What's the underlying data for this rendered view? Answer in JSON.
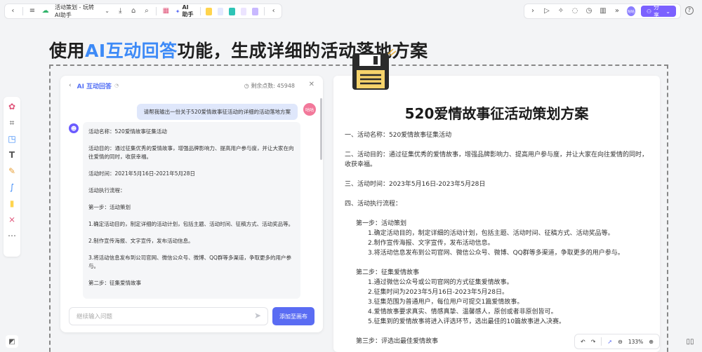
{
  "toolbar": {
    "doc_title": "活动策划 - 玩转AI助手",
    "ai_label": "AI助手",
    "share_label": "分享",
    "avatar_text": "咕咕"
  },
  "headline": {
    "prefix": "使用",
    "highlight": "AI互动回答",
    "suffix": "功能，生成详细的活动落地方案"
  },
  "chat": {
    "title": "AI 互动回答",
    "points_label": "剩余点数: 45948",
    "user_message": "请帮我输出一份关于520爱情故事征活动的详细的活动落地方案",
    "user_avatar": "咕咕",
    "answer_lines": [
      "活动名称：520爱情故事征集活动",
      "活动目的：通过征集优秀的爱情故事，增强品牌影响力、提高用户参与度，并让大家在向往爱情的同时，收获幸福。",
      "活动时间：2021年5月16日-2021年5月28日",
      "活动执行流程：",
      "第一步：活动策划",
      "1.确定活动目的，制定详细的活动计划，包括主题、活动时间、征稿方式、活动奖品等。",
      "2.制作宣传海报、文字宣传，发布活动信息。",
      "3.将活动信息发布到公司官网、微信公众号、微博、QQ群等多渠道，争取更多的用户参与。",
      "第二步：征集爱情故事"
    ],
    "input_placeholder": "继续输入问题",
    "add_button": "添加至画布"
  },
  "document": {
    "title": "520爱情故事征活动策划方案",
    "line_name": "一、活动名称：520爱情故事征集活动",
    "line_goal": "二、活动目的：通过征集优秀的爱情故事，增强品牌影响力、提高用户参与度，并让大家在向往爱情的同时，收获幸福。",
    "line_time": "三、活动时间：2023年5月16日-2023年5月28日",
    "line_flow": "四、活动执行流程：",
    "step1": "第一步：活动策划",
    "step1_items": [
      "1.确定活动目的，制定详细的活动计划，包括主题、活动时间、征稿方式、活动奖品等。",
      "2.制作宣传海报、文字宣传，发布活动信息。",
      "3.将活动信息发布到公司官网、微信公众号、微博、QQ群等多渠道，争取更多的用户参与。"
    ],
    "step2": "第二步：征集爱情故事",
    "step2_items": [
      "1.通过微信公众号或公司官网的方式征集爱情故事。",
      "2.征集时间为2023年5月16日-2023年5月28日。",
      "3.征集范围为普通用户，每位用户可提交1篇爱情故事。",
      "4.爱情故事要求真实、情感真挚、温馨感人，原创或者非原创皆可。",
      "5.征集到的爱情故事将进入评选环节，选出最佳的10篇故事进入决赛。"
    ],
    "step3": "第三步：评选出最佳爱情故事"
  },
  "zoom": {
    "level": "133%"
  },
  "colors": {
    "accent": "#7b61ff",
    "headline_ai": "#3d8af7",
    "chat_title": "#5470f5"
  }
}
